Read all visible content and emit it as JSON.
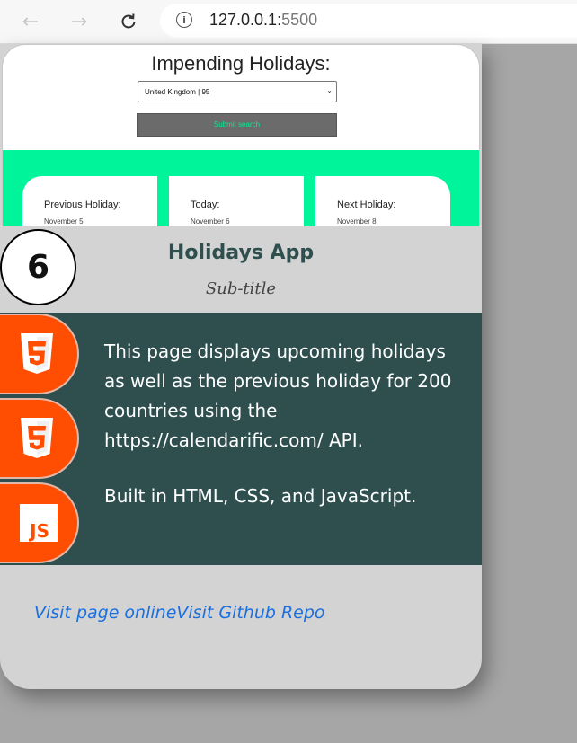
{
  "browser": {
    "url_host": "127.0.0.1:",
    "url_port": "5500"
  },
  "preview": {
    "title": "Impending Holidays:",
    "country_select_value": "United Kingdom | 95",
    "submit_label": "Submit search",
    "cards": [
      {
        "label": "Previous Holiday:",
        "date": "November 5"
      },
      {
        "label": "Today:",
        "date": "November 6"
      },
      {
        "label": "Next Holiday:",
        "date": "November 8"
      }
    ]
  },
  "project": {
    "number": "6",
    "title": "Holidays App",
    "subtitle": "Sub-title",
    "description": [
      "This page displays upcoming holidays as well as the previous holiday for 200 countries using the https://calendarific.com/ API.",
      "Built in HTML, CSS, and JavaScript."
    ],
    "tech": [
      {
        "icon": "html5-icon",
        "color": "#ff4d02"
      },
      {
        "icon": "css3-icon",
        "color": "#ff4d02"
      },
      {
        "icon": "javascript-icon",
        "color": "#ff4d02"
      }
    ],
    "links": {
      "live_label": "Visit page online",
      "repo_label": "Visit Github Repo"
    }
  },
  "colors": {
    "accent_green": "#00f59b",
    "panel": "#2f4f4f",
    "badge": "#ff4d02",
    "link": "#1a6fe0"
  }
}
